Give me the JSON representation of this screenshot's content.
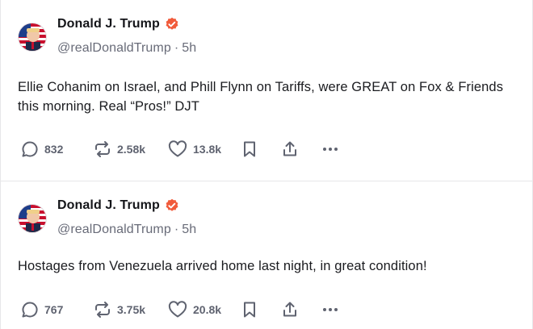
{
  "posts": [
    {
      "author": {
        "display_name": "Donald J. Trump",
        "handle": "@realDonaldTrump",
        "time": "5h"
      },
      "separator": "·",
      "text": "Ellie Cohanim on Israel, and Phill Flynn on Tariffs, were GREAT on Fox & Friends this morning. Real “Pros!” DJT",
      "stats": {
        "replies": "832",
        "reposts": "2.58k",
        "likes": "13.8k"
      },
      "icons": [
        "reply-icon",
        "repost-icon",
        "like-icon",
        "bookmark-icon",
        "share-icon",
        "more-icon"
      ]
    },
    {
      "author": {
        "display_name": "Donald J. Trump",
        "handle": "@realDonaldTrump",
        "time": "5h"
      },
      "separator": "·",
      "text": "Hostages from Venezuela arrived home last night, in great condition!",
      "stats": {
        "replies": "767",
        "reposts": "3.75k",
        "likes": "20.8k"
      },
      "icons": [
        "reply-icon",
        "repost-icon",
        "like-icon",
        "bookmark-icon",
        "share-icon",
        "more-icon"
      ]
    }
  ],
  "colors": {
    "verified_badge": "#f15b3b",
    "action_gray": "#5f6370",
    "handle_gray": "#686b78",
    "divider": "#e7e7e9"
  }
}
